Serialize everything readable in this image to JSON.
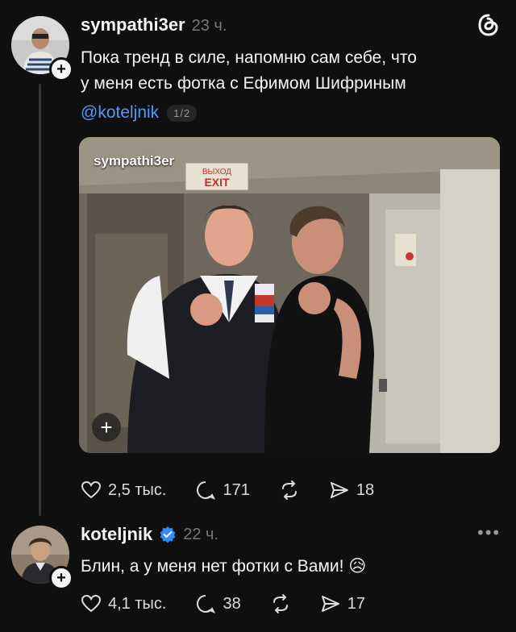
{
  "post": {
    "username": "sympathi3er",
    "time": "23 ч.",
    "text_line1": "Пока тренд в силе, напомню сам себе, что",
    "text_line2": "у меня есть фотка с Ефимом Шифриным",
    "mention": "@koteljnik",
    "page_indicator": "1/2",
    "photo_watermark": "sympathi3er",
    "photo_sign_top": "ВЫХОД",
    "photo_sign_bottom": "EXIT",
    "likes": "2,5 тыс.",
    "comments": "171",
    "shares": "18"
  },
  "reply": {
    "username": "koteljnik",
    "time": "22 ч.",
    "text": "Блин, а у меня нет фотки с Вами! 😥",
    "likes": "4,1 тыс.",
    "comments": "38",
    "shares": "17"
  },
  "colors": {
    "background": "#0f0f0f",
    "mention": "#4f9bff",
    "verified": "#2f8cff"
  }
}
